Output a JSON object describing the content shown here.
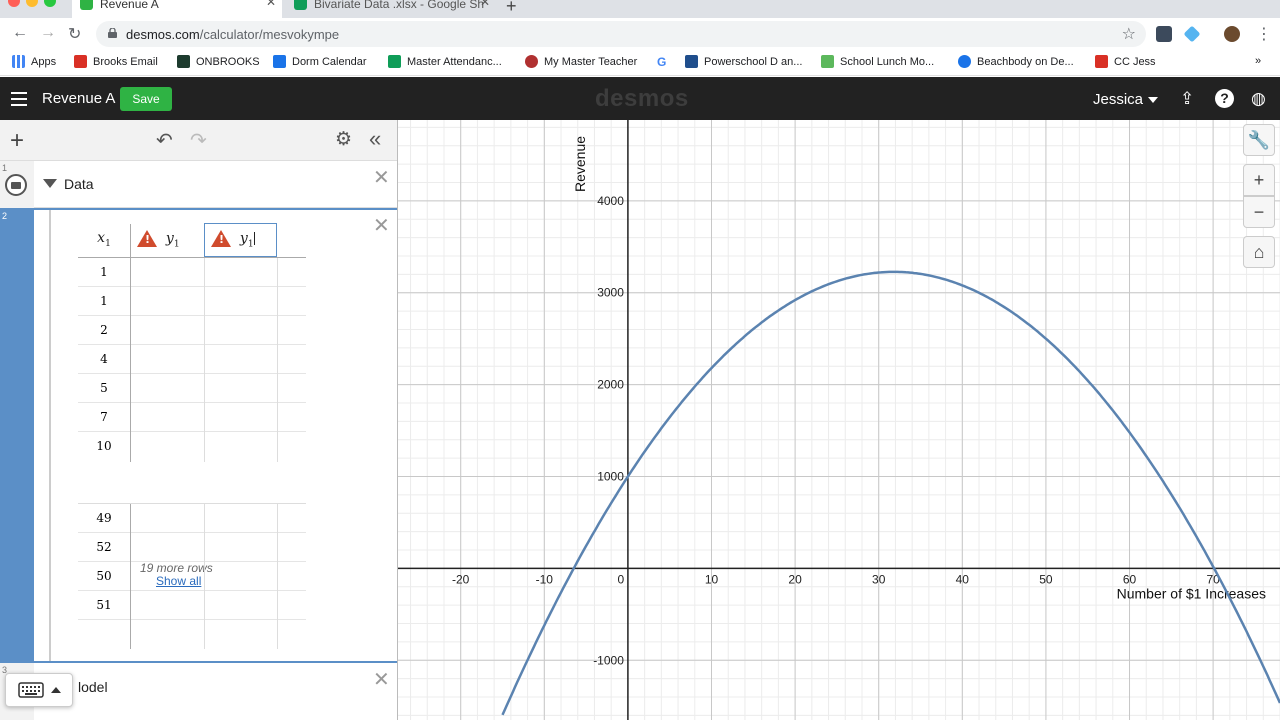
{
  "browser": {
    "tabs": [
      {
        "label": "Revenue A",
        "color": "#2fb344"
      },
      {
        "label": "Bivariate Data .xlsx - Google Sh",
        "color": "#0f9d58"
      }
    ],
    "url_host": "desmos.com",
    "url_path": "/calculator/mesvokympe",
    "bookmarks": [
      {
        "label": "Apps",
        "color": "#4285f4"
      },
      {
        "label": "Brooks Email",
        "color": "#d93025"
      },
      {
        "label": "ONBROOKS",
        "color": "#1d3b2e"
      },
      {
        "label": "Dorm Calendar",
        "color": "#1a73e8"
      },
      {
        "label": "Master Attendanc...",
        "color": "#0f9d58"
      },
      {
        "label": "My Master Teacher",
        "color": "#b03030"
      },
      {
        "label": "",
        "color": "#4285f4",
        "glyph": "G"
      },
      {
        "label": "Powerschool D an...",
        "color": "#1f4e8c"
      },
      {
        "label": "School Lunch Mo...",
        "color": "#5cb85c"
      },
      {
        "label": "Beachbody on De...",
        "color": "#1a73e8"
      },
      {
        "label": "CC Jess",
        "color": "#d93025"
      }
    ]
  },
  "header": {
    "title": "Revenue A",
    "save_label": "Save",
    "logo": "desmos",
    "user": "Jessica"
  },
  "panel": {
    "folder": {
      "num": "1",
      "title": "Data"
    },
    "table": {
      "num": "2",
      "headers": [
        "x",
        "y",
        "y"
      ],
      "subscript": "1",
      "top_rows": [
        "1",
        "1",
        "2",
        "4",
        "5",
        "7",
        "10"
      ],
      "more_rows": "19 more rows",
      "show_all": "Show all",
      "bottom_rows": [
        "49",
        "52",
        "50",
        "51"
      ]
    },
    "model": {
      "num": "3",
      "label": "lodel"
    }
  },
  "chart_data": {
    "type": "line",
    "function": "y = -2.2x^2 + 140x + 1000",
    "x_ticks": [
      -20,
      -10,
      0,
      10,
      20,
      30,
      40,
      50,
      60,
      70
    ],
    "y_ticks": [
      -1000,
      1000,
      2000,
      3000,
      4000
    ],
    "xlim": [
      -27.5,
      78
    ],
    "ylim": [
      -1650,
      4880
    ],
    "xlabel": "Number of $1 Increases",
    "ylabel": "Revenue",
    "grid": true,
    "curve_color": "#5b83b0",
    "series": [
      {
        "x": [
          -15,
          -10,
          -5,
          0,
          10,
          20,
          30,
          32,
          40,
          50,
          60,
          70,
          78
        ],
        "y": [
          -1595,
          -620,
          245,
          1000,
          2180,
          2920,
          3220,
          3227,
          3080,
          2500,
          1480,
          20,
          -1465
        ]
      }
    ]
  }
}
